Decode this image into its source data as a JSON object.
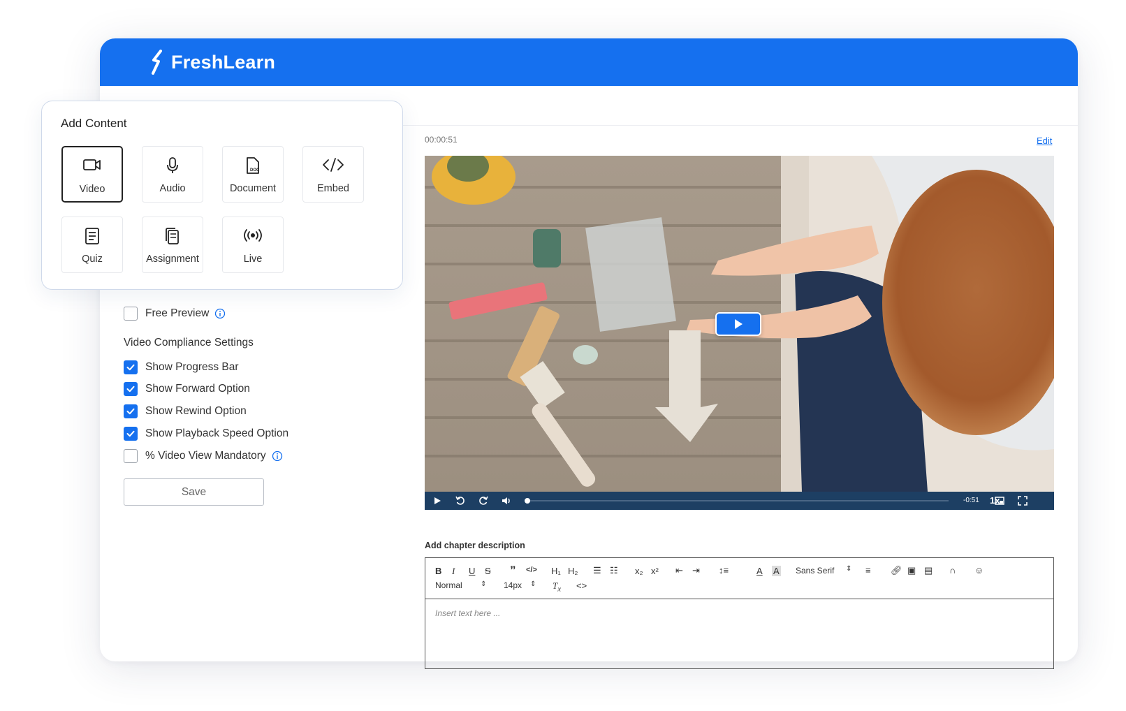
{
  "brand": {
    "name": "FreshLearn",
    "color": "#1570ef"
  },
  "add_content": {
    "title": "Add Content",
    "tiles": [
      {
        "label": "Video",
        "icon": "video-camera-icon",
        "selected": true
      },
      {
        "label": "Audio",
        "icon": "microphone-icon",
        "selected": false
      },
      {
        "label": "Document",
        "icon": "document-icon",
        "selected": false
      },
      {
        "label": "Embed",
        "icon": "code-icon",
        "selected": false
      },
      {
        "label": "Quiz",
        "icon": "quiz-list-icon",
        "selected": false
      },
      {
        "label": "Assignment",
        "icon": "assignment-stack-icon",
        "selected": false
      },
      {
        "label": "Live",
        "icon": "live-broadcast-icon",
        "selected": false
      }
    ]
  },
  "settings": {
    "free_preview": {
      "label": "Free Preview",
      "checked": false
    },
    "compliance_title": "Video Compliance Settings",
    "options": [
      {
        "label": "Show Progress Bar",
        "checked": true
      },
      {
        "label": "Show Forward Option",
        "checked": true
      },
      {
        "label": "Show Rewind Option",
        "checked": true
      },
      {
        "label": "Show Playback Speed Option",
        "checked": true
      },
      {
        "label": "% Video View Mandatory",
        "checked": false
      }
    ],
    "save_label": "Save"
  },
  "video": {
    "timestamp": "00:00:51",
    "edit_label": "Edit",
    "remaining": "-0:51",
    "speed": "1x",
    "progress_fraction": 0.0
  },
  "editor": {
    "chapter_label": "Add chapter description",
    "font_family": "Sans Serif",
    "paragraph": "Normal",
    "font_size": "14px",
    "placeholder": "Insert text here ..."
  }
}
